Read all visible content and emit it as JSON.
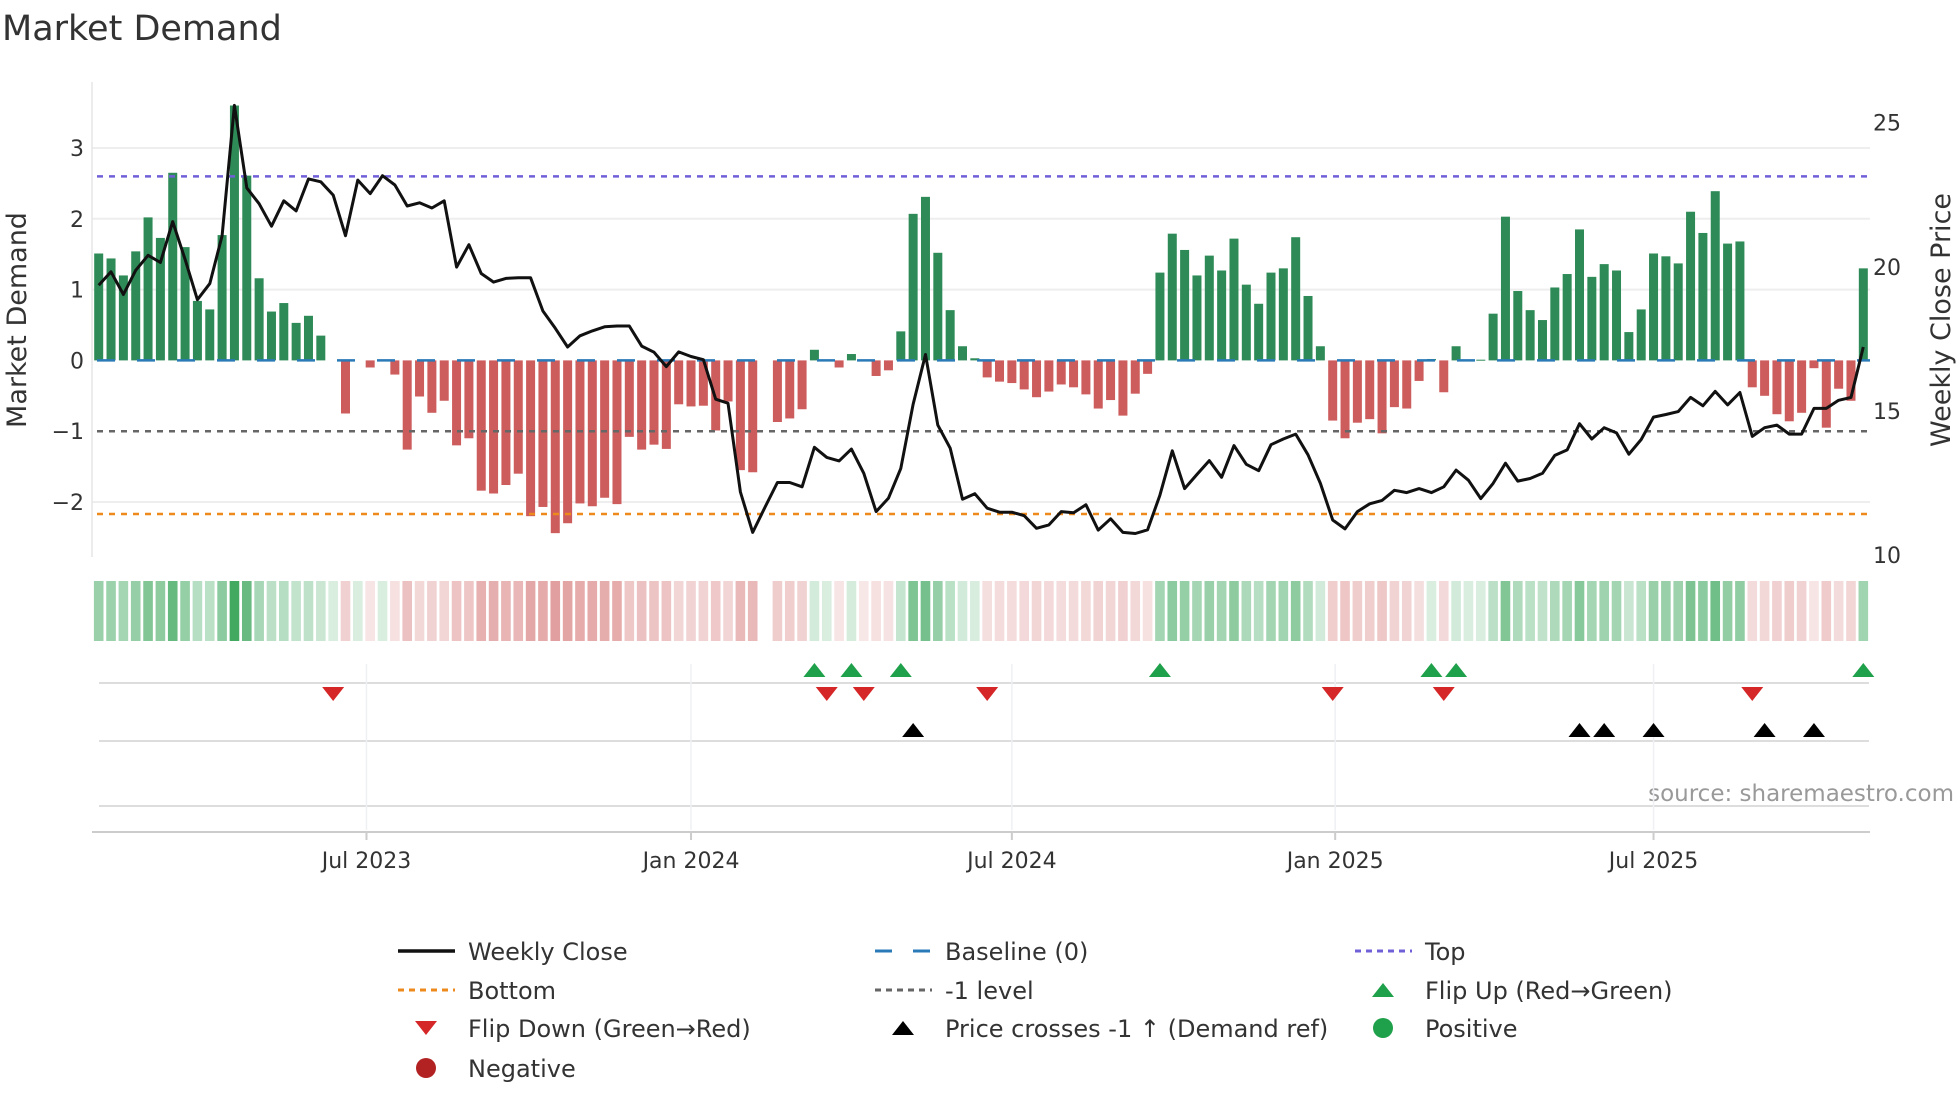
{
  "chart_data": {
    "type": "bar",
    "title": "Market Demand",
    "ylabel": "Market Demand",
    "y2label": "Weekly Close Price",
    "source": "source: sharemaestro.com",
    "ylim": [
      -2.77,
      3.93
    ],
    "y2lim": [
      9.95,
      26.4
    ],
    "yticks": [
      {
        "v": 3,
        "label": "3"
      },
      {
        "v": 2,
        "label": "2"
      },
      {
        "v": 1,
        "label": "1"
      },
      {
        "v": 0,
        "label": "0"
      },
      {
        "v": -1,
        "label": "−1"
      },
      {
        "v": -2,
        "label": "−2"
      }
    ],
    "y2ticks": [
      {
        "v": 25,
        "label": "25"
      },
      {
        "v": 20,
        "label": "20"
      },
      {
        "v": 15,
        "label": "15"
      },
      {
        "v": 10,
        "label": "10"
      }
    ],
    "xticks": [
      {
        "week_index": 21.7,
        "label": "Jul 2023"
      },
      {
        "week_index": 48.0,
        "label": "Jan 2024"
      },
      {
        "week_index": 74.0,
        "label": "Jul 2024"
      },
      {
        "week_index": 100.2,
        "label": "Jan 2025"
      },
      {
        "week_index": 126.0,
        "label": "Jul 2025"
      }
    ],
    "levels": {
      "top": 2.6,
      "bottom": -2.17,
      "minus_one": -1,
      "baseline": 0
    },
    "demand": [
      1.51,
      1.44,
      1.2,
      1.54,
      2.02,
      1.73,
      2.65,
      1.6,
      0.84,
      0.72,
      1.77,
      3.6,
      2.61,
      1.16,
      0.69,
      0.81,
      0.53,
      0.63,
      0.35,
      0,
      -0.75,
      0,
      -0.1,
      0,
      -0.2,
      -1.26,
      -0.51,
      -0.74,
      -0.57,
      -1.2,
      -1.1,
      -1.84,
      -1.88,
      -1.76,
      -1.6,
      -2.2,
      -2.07,
      -2.44,
      -2.3,
      -2.02,
      -2.06,
      -1.94,
      -2.03,
      -1.08,
      -1.26,
      -1.19,
      -1.25,
      -0.62,
      -0.65,
      -0.64,
      -0.99,
      -0.58,
      -1.55,
      -1.58,
      null,
      -0.87,
      -0.82,
      -0.69,
      0.15,
      0,
      -0.1,
      0.09,
      -0.01,
      -0.22,
      -0.14,
      0.41,
      2.07,
      2.31,
      1.52,
      0.71,
      0.2,
      0.03,
      -0.24,
      -0.3,
      -0.32,
      -0.41,
      -0.52,
      -0.44,
      -0.34,
      -0.38,
      -0.48,
      -0.68,
      -0.56,
      -0.78,
      -0.47,
      -0.19,
      1.24,
      1.79,
      1.56,
      1.2,
      1.48,
      1.27,
      1.72,
      1.07,
      0.8,
      1.24,
      1.3,
      1.74,
      0.91,
      0.2,
      -0.85,
      -1.1,
      -0.88,
      -0.83,
      -1.03,
      -0.66,
      -0.68,
      -0.29,
      0.02,
      -0.45,
      0.2,
      0,
      0.01,
      0.66,
      2.03,
      0.98,
      0.71,
      0.57,
      1.03,
      1.22,
      1.85,
      1.18,
      1.36,
      1.27,
      0.4,
      0.72,
      1.51,
      1.47,
      1.37,
      2.1,
      1.8,
      2.39,
      1.65,
      1.68,
      -0.38,
      -0.5,
      -0.76,
      -0.86,
      -0.74,
      -0.11,
      -0.95,
      -0.4,
      -0.57,
      1.3
    ],
    "weekly_close": [
      19.36,
      19.83,
      19.04,
      19.88,
      20.4,
      20.15,
      21.57,
      20.26,
      18.86,
      19.42,
      21.08,
      25.6,
      22.74,
      22.19,
      21.41,
      22.29,
      21.94,
      23.05,
      22.95,
      22.49,
      21.08,
      23.01,
      22.54,
      23.16,
      22.84,
      22.11,
      22.22,
      22.04,
      22.29,
      19.99,
      20.77,
      19.77,
      19.47,
      19.6,
      19.62,
      19.62,
      18.47,
      17.87,
      17.22,
      17.61,
      17.78,
      17.92,
      17.95,
      17.95,
      17.25,
      17.04,
      16.54,
      17.05,
      16.89,
      16.78,
      15.41,
      15.27,
      12.19,
      10.79,
      11.67,
      12.52,
      12.52,
      12.37,
      13.74,
      13.39,
      13.27,
      13.68,
      12.84,
      11.51,
      11.98,
      13.01,
      15.23,
      16.96,
      14.51,
      13.71,
      11.94,
      12.13,
      11.63,
      11.49,
      11.49,
      11.37,
      10.93,
      11.05,
      11.51,
      11.47,
      11.75,
      10.87,
      11.26,
      10.79,
      10.75,
      10.88,
      12.08,
      13.62,
      12.31,
      12.8,
      13.28,
      12.7,
      13.8,
      13.15,
      12.93,
      13.83,
      14.03,
      14.2,
      13.48,
      12.49,
      11.22,
      10.91,
      11.51,
      11.78,
      11.9,
      12.25,
      12.17,
      12.31,
      12.17,
      12.37,
      12.95,
      12.6,
      11.96,
      12.49,
      13.19,
      12.57,
      12.66,
      12.84,
      13.46,
      13.65,
      14.56,
      14.03,
      14.42,
      14.24,
      13.5,
      14.01,
      14.79,
      14.88,
      14.98,
      15.47,
      15.18,
      15.68,
      15.21,
      15.64,
      14.12,
      14.42,
      14.51,
      14.2,
      14.2,
      15.09,
      15.09,
      15.37,
      15.47,
      17.22
    ],
    "flip_up_weeks": [
      58,
      61,
      65,
      86,
      108,
      110,
      143
    ],
    "flip_down_weeks": [
      19,
      59,
      62,
      72,
      100,
      109,
      134
    ],
    "price_cross_weeks": [
      66,
      120,
      122,
      126,
      135,
      139
    ],
    "colors": {
      "positive": "#2e8b57",
      "negative": "#cd5c5c",
      "line": "#111111",
      "top": "#7060d8",
      "bottom": "#ee8a1c",
      "minus_one": "#666666",
      "baseline": "#2a7ab8",
      "flip_up": "#1fa04a",
      "flip_down": "#d62728",
      "cross": "#000000",
      "neg_dot": "#b22222",
      "pos_dot": "#1fa04a"
    },
    "legend": [
      {
        "key": "weekly_close",
        "label": "Weekly Close",
        "symbol": "line"
      },
      {
        "key": "baseline",
        "label": "Baseline (0)",
        "symbol": "dash"
      },
      {
        "key": "top",
        "label": "Top",
        "symbol": "dot"
      },
      {
        "key": "bottom",
        "label": "Bottom",
        "symbol": "dot"
      },
      {
        "key": "minus_one",
        "label": "-1 level",
        "symbol": "dot"
      },
      {
        "key": "flip_up",
        "label": "Flip Up (Red→Green)",
        "symbol": "tri-up"
      },
      {
        "key": "flip_down",
        "label": "Flip Down (Green→Red)",
        "symbol": "tri-down"
      },
      {
        "key": "cross",
        "label": "Price crosses -1 ↑ (Demand ref)",
        "symbol": "tri-up"
      },
      {
        "key": "pos_dot",
        "label": "Positive",
        "symbol": "circle"
      },
      {
        "key": "neg_dot",
        "label": "Negative",
        "symbol": "circle"
      }
    ],
    "legend_placement": "bottom"
  }
}
